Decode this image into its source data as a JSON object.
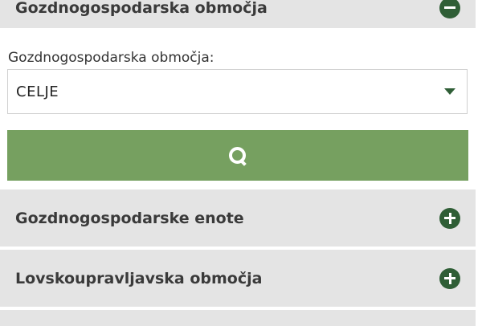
{
  "accordion": {
    "top": {
      "title": "Gozdnogospodarska območja",
      "state": "expanded"
    },
    "enote": {
      "title": "Gozdnogospodarske enote",
      "state": "collapsed"
    },
    "lovsko": {
      "title": "Lovskoupravljavska območja",
      "state": "collapsed"
    }
  },
  "form": {
    "label": "Gozdnogospodarska območja:",
    "selected": "CELJE"
  },
  "search_button": {
    "icon": "search-icon"
  },
  "colors": {
    "accent": "#76a060",
    "icon": "#2f5e36",
    "header_bg": "#e4e4e4"
  }
}
